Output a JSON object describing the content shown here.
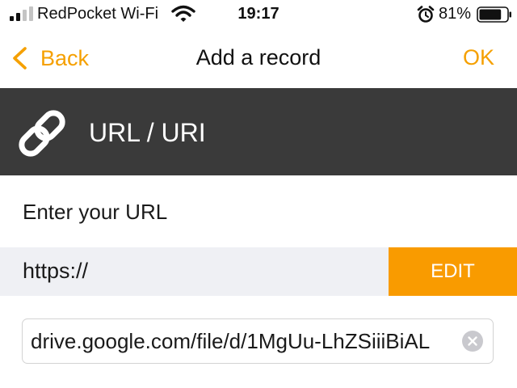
{
  "status_bar": {
    "carrier": "RedPocket Wi-Fi",
    "time": "19:17",
    "battery_percent": "81%",
    "battery_level": 0.81,
    "icons": [
      "signal-icon",
      "wifi-icon",
      "alarm-icon",
      "battery-icon"
    ]
  },
  "nav": {
    "back_label": "Back",
    "title": "Add a record",
    "ok_label": "OK",
    "accent_color": "#f5a000"
  },
  "record_type": {
    "title": "URL / URI",
    "icon": "link-icon",
    "background_color": "#3a3a3a"
  },
  "form": {
    "prompt": "Enter your URL",
    "scheme": "https://",
    "edit_label": "EDIT",
    "edit_color": "#f99b00",
    "url_value": "drive.google.com/file/d/1MgUu-LhZSiiiBiAL"
  }
}
